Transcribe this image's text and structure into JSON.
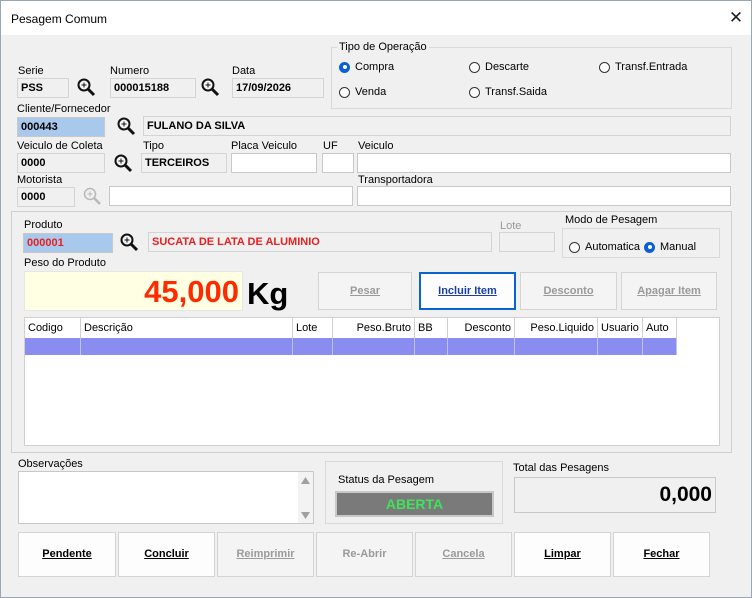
{
  "window": {
    "title": "Pesagem Comum",
    "close": "✕"
  },
  "header": {
    "serie_label": "Serie",
    "serie_value": "PSS",
    "numero_label": "Numero",
    "numero_value": "000015188",
    "data_label": "Data",
    "data_value": "17/09/2026"
  },
  "operacao": {
    "title": "Tipo de Operação",
    "options": [
      {
        "label": "Compra",
        "selected": true
      },
      {
        "label": "Descarte",
        "selected": false
      },
      {
        "label": "Transf.Entrada",
        "selected": false
      },
      {
        "label": "Venda",
        "selected": false
      },
      {
        "label": "Transf.Saida",
        "selected": false
      }
    ]
  },
  "cliente": {
    "label": "Cliente/Fornecedor",
    "code": "000443",
    "name": "FULANO DA SILVA"
  },
  "veiculo": {
    "coleta_label": "Veiculo de Coleta",
    "coleta_value": "0000",
    "tipo_label": "Tipo",
    "tipo_value": "TERCEIROS",
    "placa_label": "Placa Veiculo",
    "placa_value": "",
    "uf_label": "UF",
    "uf_value": "",
    "veiculo_label": "Veiculo",
    "veiculo_value": ""
  },
  "motorista": {
    "label": "Motorista",
    "code": "0000",
    "name": "",
    "transportadora_label": "Transportadora",
    "transportadora_value": ""
  },
  "produto": {
    "label": "Produto",
    "code": "000001",
    "name": "SUCATA DE LATA DE ALUMINIO",
    "lote_label": "Lote",
    "lote_value": ""
  },
  "modo": {
    "title": "Modo de Pesagem",
    "options": [
      {
        "label": "Automatica",
        "selected": false
      },
      {
        "label": "Manual",
        "selected": true
      }
    ]
  },
  "peso": {
    "label": "Peso do Produto",
    "value": "45,000",
    "unit": "Kg"
  },
  "actions": {
    "pesar": "Pesar",
    "incluir": "Incluir Item",
    "desconto": "Desconto",
    "apagar": "Apagar Item"
  },
  "grid": {
    "columns": [
      "Codigo",
      "Descrição",
      "Lote",
      "Peso.Bruto",
      "BB",
      "Desconto",
      "Peso.Liquido",
      "Usuario",
      "Auto"
    ]
  },
  "observacoes": {
    "label": "Observações",
    "value": ""
  },
  "status": {
    "label": "Status da Pesagem",
    "value": "ABERTA",
    "color": "#3ee35a"
  },
  "total": {
    "label": "Total das Pesagens",
    "value": "0,000"
  },
  "footer": {
    "pendente": "Pendente",
    "concluir": "Concluir",
    "reimprimir": "Reimprimir",
    "reabrir": "Re-Abrir",
    "cancela": "Cancela",
    "limpar": "Limpar",
    "fechar": "Fechar"
  },
  "colors": {
    "peso_value": "#ff2a00",
    "produto_name": "#e82020",
    "selected_row": "#8a8df0",
    "focus_border": "#0a64d0"
  }
}
